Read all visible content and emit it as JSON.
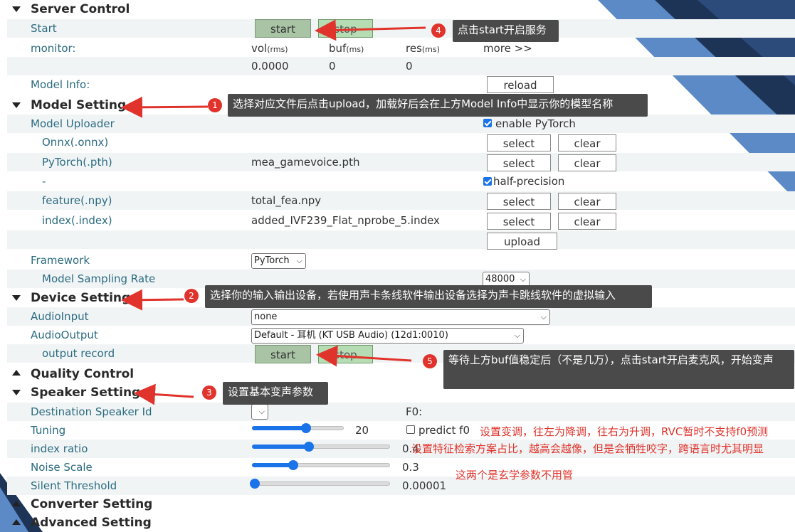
{
  "server_control": {
    "title": "Server Control",
    "start_label": "Start",
    "start_button": "start",
    "stop_button": "stop",
    "monitor_label": "monitor:",
    "vol_label": "vol",
    "vol_unit": "(rms)",
    "buf_label": "buf",
    "buf_unit": "(ms)",
    "res_label": "res",
    "res_unit": "(ms)",
    "more_label": "more >>",
    "vol_value": "0.0000",
    "buf_value": "0",
    "res_value": "0",
    "model_info_label": "Model Info:",
    "reload_button": "reload"
  },
  "model_setting": {
    "title": "Model Setting",
    "uploader_label": "Model Uploader",
    "enable_pytorch_label": "enable PyTorch",
    "enable_pytorch_checked": true,
    "onnx_label": "Onnx(.onnx)",
    "pytorch_label": "PyTorch(.pth)",
    "pytorch_file": "mea_gamevoice.pth",
    "dash_label": "-",
    "half_precision_label": "half-precision",
    "half_precision_checked": true,
    "feature_label": "feature(.npy)",
    "feature_file": "total_fea.npy",
    "index_label": "index(.index)",
    "index_file": "added_IVF239_Flat_nprobe_5.index",
    "select_button": "select",
    "clear_button": "clear",
    "upload_button": "upload",
    "framework_label": "Framework",
    "framework_value": "PyTorch",
    "sampling_label": "Model Sampling Rate",
    "sampling_value": "48000"
  },
  "device_setting": {
    "title": "Device Setting",
    "audio_input_label": "AudioInput",
    "audio_input_value": "none",
    "audio_output_label": "AudioOutput",
    "audio_output_value": "Default - 耳机 (KT USB Audio) (12d1:0010)",
    "output_record_label": "output record",
    "start_button": "start",
    "stop_button": "stop"
  },
  "quality_control": {
    "title": "Quality Control"
  },
  "speaker_setting": {
    "title": "Speaker Setting",
    "dest_speaker_label": "Destination Speaker Id",
    "f0_label": "F0:",
    "tuning_label": "Tuning",
    "tuning_value": "20",
    "tuning_fraction": 0.59,
    "predict_f0_label": "predict f0",
    "predict_f0_checked": false,
    "index_ratio_label": "index ratio",
    "index_ratio_value": "0.4",
    "index_ratio_fraction": 0.41,
    "noise_scale_label": "Noise Scale",
    "noise_scale_value": "0.3",
    "noise_scale_fraction": 0.3,
    "silent_threshold_label": "Silent Threshold",
    "silent_threshold_value": "0.00001",
    "silent_threshold_fraction": 0.02
  },
  "converter_setting": {
    "title": "Converter Setting"
  },
  "advanced_setting": {
    "title": "Advanced Setting"
  },
  "annotations": {
    "c1_num": "1",
    "c1_text": "选择对应文件后点击upload，加载好后会在上方Model Info中显示你的模型名称",
    "c2_num": "2",
    "c2_text": "选择你的输入输出设备，若使用声卡条线软件输出设备选择为声卡跳线软件的虚拟输入",
    "c3_num": "3",
    "c3_text": "设置基本变声参数",
    "c4_num": "4",
    "c4_text": "点击start开启服务",
    "c5_num": "5",
    "c5_text": "等待上方buf值稳定后（不是几万），点击start开启麦克风，开始变声",
    "note_tuning": "设置变调，往左为降调，往右为升调，RVC暂时不支持f0预测",
    "note_index": "设置特征检索方案占比，越高会越像，但是会牺牲咬字，跨语言时尤其明显",
    "note_noise": "这两个是玄学参数不用管"
  },
  "colors": {
    "accent": "#1a73e8",
    "callout_bg": "#4a4a4a",
    "annotation_red": "#e0332b",
    "label_teal": "#2b6b80",
    "start_green": "#a9c4a4",
    "stop_green": "#b6dcb3",
    "decor_blue": "#5b8ac6",
    "decor_navy": "#1e3457"
  }
}
